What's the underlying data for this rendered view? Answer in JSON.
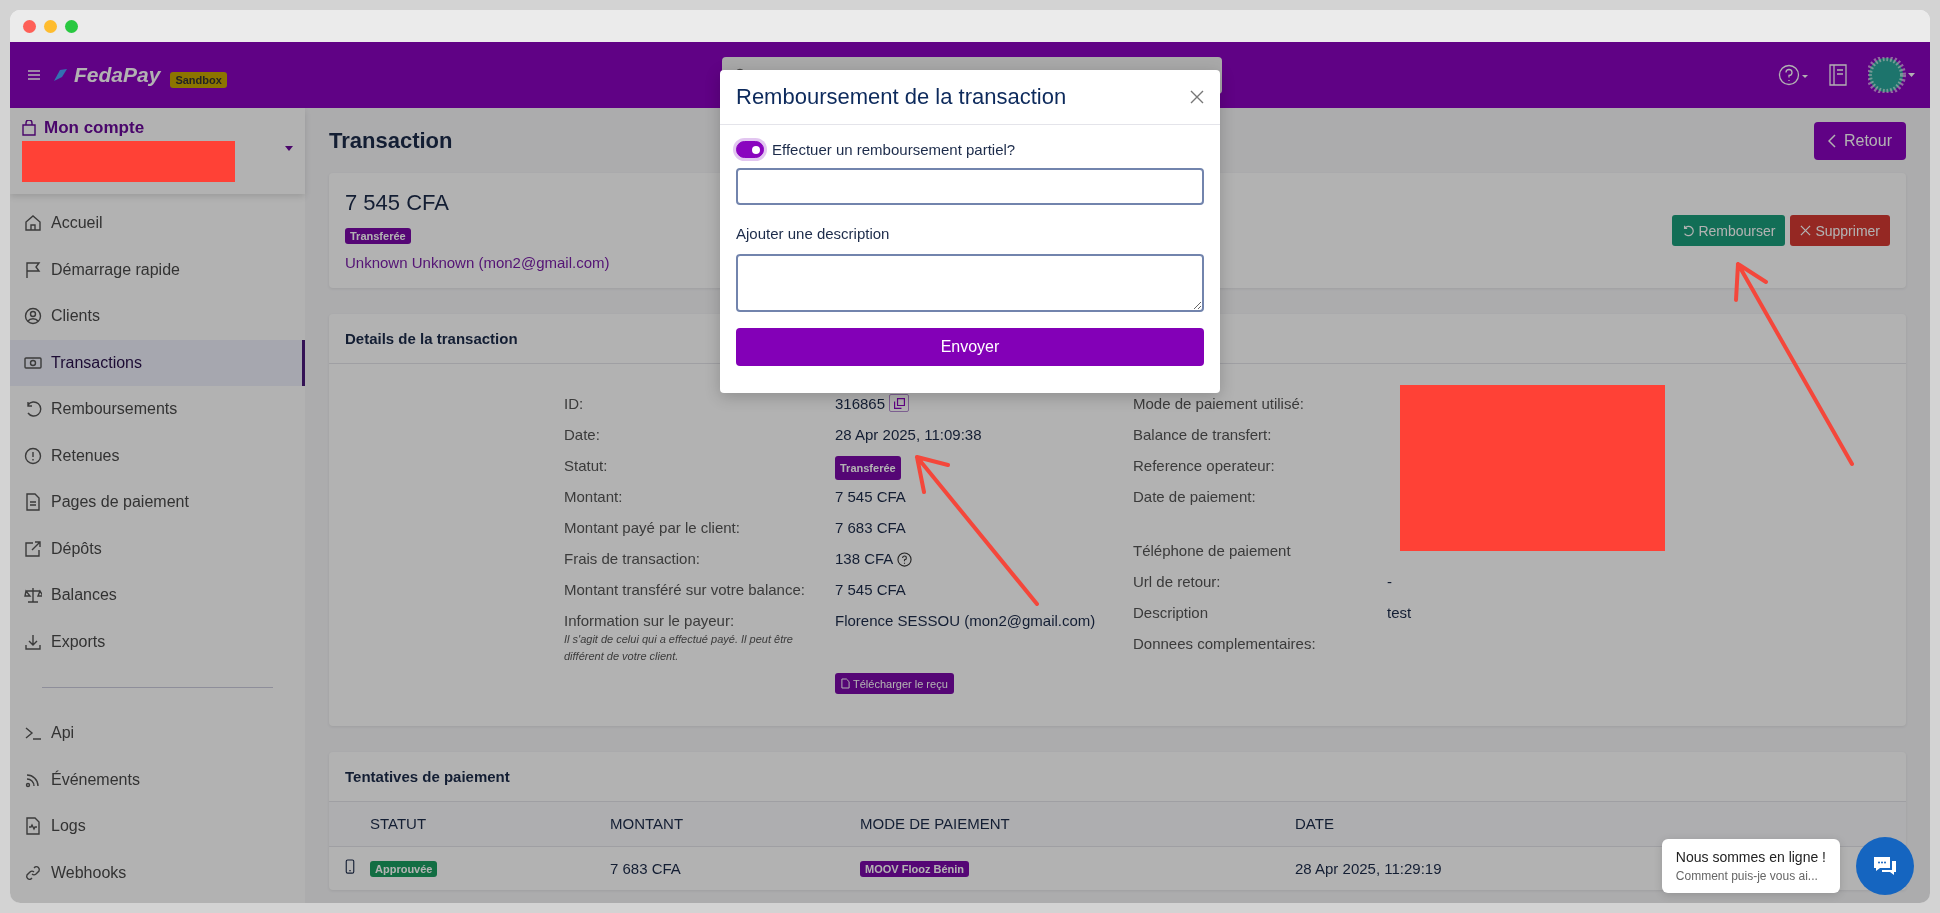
{
  "header": {
    "logo": "FedaPay",
    "env_badge": "Sandbox"
  },
  "account": {
    "label": "Mon compte"
  },
  "sidebar": {
    "groups": [
      [
        {
          "label": "Accueil",
          "selected": false
        },
        {
          "label": "Démarrage rapide",
          "selected": false
        },
        {
          "label": "Clients",
          "selected": false
        },
        {
          "label": "Transactions",
          "selected": true
        },
        {
          "label": "Remboursements",
          "selected": false
        },
        {
          "label": "Retenues",
          "selected": false
        },
        {
          "label": "Pages de paiement",
          "selected": false
        },
        {
          "label": "Dépôts",
          "selected": false
        },
        {
          "label": "Balances",
          "selected": false
        },
        {
          "label": "Exports",
          "selected": false
        }
      ],
      [
        {
          "label": "Api",
          "selected": false
        },
        {
          "label": "Événements",
          "selected": false
        },
        {
          "label": "Logs",
          "selected": false
        },
        {
          "label": "Webhooks",
          "selected": false
        }
      ]
    ]
  },
  "page": {
    "title": "Transaction",
    "back_button": "Retour"
  },
  "summary": {
    "amount": "7 545 CFA",
    "status": "Transferée",
    "customer": "Unknown Unknown (mon2@gmail.com)",
    "buttons": [
      {
        "label": "Rembourser",
        "kind": "refund"
      },
      {
        "label": "Supprimer",
        "kind": "delete"
      }
    ]
  },
  "details": {
    "title": "Details de la transaction",
    "left": [
      {
        "label": "ID:",
        "value": "316865",
        "kind": "copy"
      },
      {
        "label": "Date:",
        "value": "28 Apr 2025, 11:09:38",
        "kind": "text"
      },
      {
        "label": "Statut:",
        "value": "Transferée",
        "kind": "badge"
      },
      {
        "label": "Montant:",
        "value": "7 545 CFA",
        "kind": "text"
      },
      {
        "label": "Montant payé par le client:",
        "value": "7 683 CFA",
        "kind": "text"
      },
      {
        "label": "Frais de transaction:",
        "value": "138 CFA",
        "kind": "help"
      },
      {
        "label": "Montant transféré sur votre balance:",
        "value": "7 545 CFA",
        "kind": "text"
      },
      {
        "label": "Information sur le payeur:",
        "note": "Il s'agit de celui qui a effectué payé. Il peut être différent de votre client.",
        "value": "Florence SESSOU (mon2@gmail.com)",
        "kind": "text"
      }
    ],
    "right": [
      {
        "label": "Mode de paiement utilisé:",
        "kind": "text"
      },
      {
        "label": "Balance de transfert:",
        "kind": "text"
      },
      {
        "label": "Reference operateur:",
        "kind": "text"
      },
      {
        "label": "Date de paiement:",
        "kind": "text"
      },
      {
        "label": "Téléphone de paiement",
        "kind": "spaced"
      },
      {
        "label": "Url de retour:",
        "value": "-",
        "kind": "text"
      },
      {
        "label": "Description",
        "value": "test",
        "kind": "text"
      },
      {
        "label": "Donnees complementaires:",
        "kind": "text"
      }
    ],
    "download_button": "Télécharger le reçu"
  },
  "attempts": {
    "title": "Tentatives de paiement",
    "columns": [
      "STATUT",
      "MONTANT",
      "MODE DE PAIEMENT",
      "DATE"
    ],
    "rows": [
      {
        "status": "Approuvée",
        "amount": "7 683 CFA",
        "method": "MOOV Flooz Bénin",
        "date": "28 Apr 2025, 11:29:19"
      }
    ]
  },
  "modal": {
    "title": "Remboursement de la transaction",
    "partial_toggle": {
      "label": "Effectuer un remboursement partiel?",
      "on": true
    },
    "description_label": "Ajouter une description",
    "submit": "Envoyer"
  },
  "chat": {
    "title": "Nous sommes en ligne !",
    "subtitle": "Comment puis-je vous ai..."
  }
}
